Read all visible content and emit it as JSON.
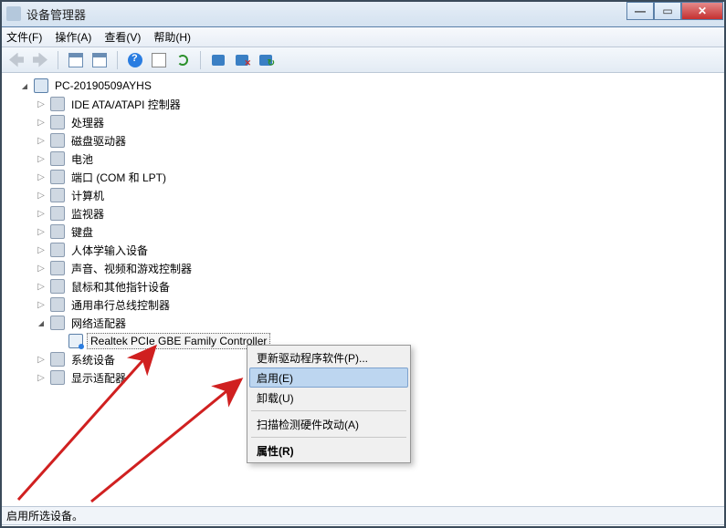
{
  "window": {
    "title": "设备管理器"
  },
  "menubar": {
    "file": "文件(F)",
    "action": "操作(A)",
    "view": "查看(V)",
    "help": "帮助(H)"
  },
  "tree": {
    "root": "PC-20190509AYHS",
    "categories": [
      {
        "label": "IDE ATA/ATAPI 控制器",
        "expanded": false
      },
      {
        "label": "处理器",
        "expanded": false
      },
      {
        "label": "磁盘驱动器",
        "expanded": false
      },
      {
        "label": "电池",
        "expanded": false
      },
      {
        "label": "端口 (COM 和 LPT)",
        "expanded": false
      },
      {
        "label": "计算机",
        "expanded": false
      },
      {
        "label": "监视器",
        "expanded": false
      },
      {
        "label": "键盘",
        "expanded": false
      },
      {
        "label": "人体学输入设备",
        "expanded": false
      },
      {
        "label": "声音、视频和游戏控制器",
        "expanded": false
      },
      {
        "label": "鼠标和其他指针设备",
        "expanded": false
      },
      {
        "label": "通用串行总线控制器",
        "expanded": false
      },
      {
        "label": "网络适配器",
        "expanded": true
      },
      {
        "label": "系统设备",
        "expanded": false
      },
      {
        "label": "显示适配器",
        "expanded": false
      }
    ],
    "selected_device": "Realtek PCIe GBE Family Controller"
  },
  "context_menu": {
    "items": {
      "update_driver": "更新驱动程序软件(P)...",
      "enable": "启用(E)",
      "uninstall": "卸载(U)",
      "scan": "扫描检测硬件改动(A)",
      "properties": "属性(R)"
    }
  },
  "statusbar": {
    "text": "启用所选设备。"
  }
}
